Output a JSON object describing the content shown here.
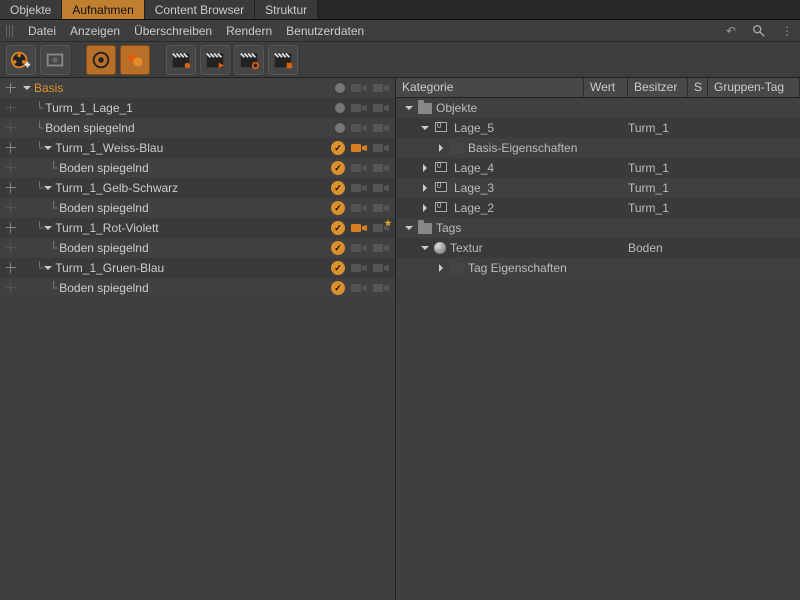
{
  "tabs": [
    "Objekte",
    "Aufnahmen",
    "Content Browser",
    "Struktur"
  ],
  "active_tab": 1,
  "menu": [
    "Datei",
    "Anzeigen",
    "Überschreiben",
    "Rendern",
    "Benutzerdaten"
  ],
  "tree": [
    {
      "label": "Basis",
      "depth": 0,
      "root": true,
      "expand": "down",
      "status": "dot",
      "cam": "plain",
      "cross": "on"
    },
    {
      "label": "Turm_1_Lage_1",
      "depth": 1,
      "status": "dot",
      "cam": "plain",
      "cross": "dim"
    },
    {
      "label": "Boden spiegelnd",
      "depth": 1,
      "status": "dot",
      "cam": "plain",
      "cross": "dim"
    },
    {
      "label": "Turm_1_Weiss-Blau",
      "depth": 1,
      "expand": "down",
      "status": "check",
      "cam": "lit",
      "cross": "on"
    },
    {
      "label": "Boden spiegelnd",
      "depth": 2,
      "status": "check",
      "cam": "plain",
      "cross": "dim"
    },
    {
      "label": "Turm_1_Gelb-Schwarz",
      "depth": 1,
      "expand": "down",
      "status": "check",
      "cam": "plain",
      "cross": "on"
    },
    {
      "label": "Boden spiegelnd",
      "depth": 2,
      "status": "check",
      "cam": "plain",
      "cross": "dim"
    },
    {
      "label": "Turm_1_Rot-Violett",
      "depth": 1,
      "expand": "down",
      "status": "check",
      "cam": "lit",
      "cam2star": true,
      "cross": "on"
    },
    {
      "label": "Boden spiegelnd",
      "depth": 2,
      "status": "check",
      "cam": "plain",
      "cross": "dim"
    },
    {
      "label": "Turm_1_Gruen-Blau",
      "depth": 1,
      "expand": "down",
      "status": "check",
      "cam": "plain",
      "cross": "on"
    },
    {
      "label": "Boden spiegelnd",
      "depth": 2,
      "status": "check",
      "cam": "plain",
      "cross": "dim"
    }
  ],
  "columns": {
    "kategorie": "Kategorie",
    "wert": "Wert",
    "besitzer": "Besitzer",
    "s": "S",
    "gruppen": "Gruppen-Tag"
  },
  "categories": [
    {
      "label": "Objekte",
      "depth": 0,
      "type": "folder-open",
      "expand": "down",
      "besitzer": ""
    },
    {
      "label": "Lage_5",
      "depth": 1,
      "type": "layer",
      "expand": "down",
      "besitzer": "Turm_1"
    },
    {
      "label": "Basis-Eigenschaften",
      "depth": 2,
      "type": "folder-dark",
      "expand": "right",
      "besitzer": ""
    },
    {
      "label": "Lage_4",
      "depth": 1,
      "type": "layer",
      "expand": "right",
      "besitzer": "Turm_1"
    },
    {
      "label": "Lage_3",
      "depth": 1,
      "type": "layer",
      "expand": "right",
      "besitzer": "Turm_1"
    },
    {
      "label": "Lage_2",
      "depth": 1,
      "type": "layer",
      "expand": "right",
      "besitzer": "Turm_1"
    },
    {
      "label": "Tags",
      "depth": 0,
      "type": "folder-open",
      "expand": "down",
      "besitzer": ""
    },
    {
      "label": "Textur",
      "depth": 1,
      "type": "sphere",
      "expand": "down",
      "besitzer": "Boden"
    },
    {
      "label": "Tag Eigenschaften",
      "depth": 2,
      "type": "folder-dark",
      "expand": "right",
      "besitzer": ""
    }
  ]
}
